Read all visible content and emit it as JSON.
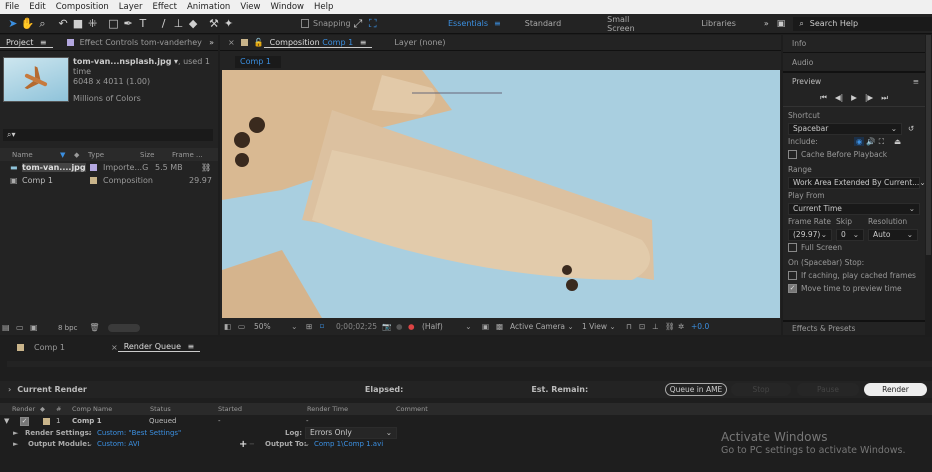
{
  "menu": [
    "File",
    "Edit",
    "Composition",
    "Layer",
    "Effect",
    "Animation",
    "View",
    "Window",
    "Help"
  ],
  "toolbar": {
    "snapping": "Snapping",
    "workspaces": [
      "Essentials",
      "Standard",
      "Small Screen",
      "Libraries"
    ],
    "active_workspace": "Essentials",
    "search_placeholder": "Search Help"
  },
  "project": {
    "tab": "Project",
    "effect_controls_tab": "Effect Controls tom-vanderhey",
    "file_title": "tom-van...nsplash.jpg",
    "used": ", used 1 time",
    "dimensions": "6048 x 4011 (1.00)",
    "colors": "Millions of Colors",
    "search_placeholder": "",
    "columns": [
      "Name",
      "Type",
      "Size",
      "Frame ..."
    ],
    "items": [
      {
        "name": "tom-van....jpg",
        "type": "Importe...G",
        "size": "5.5 MB",
        "frame": "",
        "color": "#b4a8e0"
      },
      {
        "name": "Comp 1",
        "type": "Composition",
        "size": "",
        "frame": "29.97",
        "color": "#c9b48a"
      }
    ],
    "bpc": "8 bpc"
  },
  "composition": {
    "tab_prefix": "Composition",
    "tab_name": "Comp 1",
    "layer_tab": "Layer (none)",
    "subtab": "Comp 1",
    "footer": {
      "zoom": "50%",
      "timecode": "0;00;02;25",
      "resolution": "(Half)",
      "camera": "Active Camera",
      "views": "1 View",
      "exposure": "+0.0"
    }
  },
  "right": {
    "info": "Info",
    "audio": "Audio",
    "preview": "Preview",
    "shortcut_label": "Shortcut",
    "shortcut": "Spacebar",
    "include": "Include:",
    "cache": "Cache Before Playback",
    "cache_checked": false,
    "range_label": "Range",
    "range": "Work Area Extended By Current...",
    "play_from_label": "Play From",
    "play_from": "Current Time",
    "frame_rate_label": "Frame Rate",
    "skip_label": "Skip",
    "resolution_label": "Resolution",
    "frame_rate": "(29.97)",
    "skip": "0",
    "resolution": "Auto",
    "full_screen": "Full Screen",
    "full_screen_checked": false,
    "stop_label": "On (Spacebar) Stop:",
    "if_caching": "If caching, play cached frames",
    "if_caching_checked": false,
    "move_time": "Move time to preview time",
    "move_time_checked": true,
    "effects": "Effects & Presets"
  },
  "bottom": {
    "tabs": [
      "Comp 1",
      "Render Queue"
    ],
    "active_tab": "Render Queue",
    "current_render": "Current Render",
    "elapsed": "Elapsed:",
    "est_remain": "Est. Remain:",
    "buttons": {
      "queue_ame": "Queue in AME",
      "stop": "Stop",
      "pause": "Pause",
      "render": "Render"
    },
    "columns": [
      "Render",
      "#",
      "Comp Name",
      "Status",
      "Started",
      "Render Time",
      "Comment"
    ],
    "item": {
      "number": "1",
      "comp": "Comp 1",
      "status": "Queued",
      "started": "-",
      "render_time": "-",
      "render_checked": true
    },
    "render_settings_label": "Render Settings:",
    "render_settings": "Custom: \"Best Settings\"",
    "log_label": "Log:",
    "log": "Errors Only",
    "output_module_label": "Output Module:",
    "output_module": "Custom: AVI",
    "output_to_label": "Output To:",
    "output_to": "Comp 1\\Comp 1.avi"
  },
  "watermark": {
    "title": "Activate Windows",
    "subtitle": "Go to PC settings to activate Windows."
  },
  "colors": {
    "accent": "#3b8fe0",
    "sky": "#a9cfe0",
    "comp_label": "#c9b48a",
    "footage_label": "#b4a8e0"
  }
}
